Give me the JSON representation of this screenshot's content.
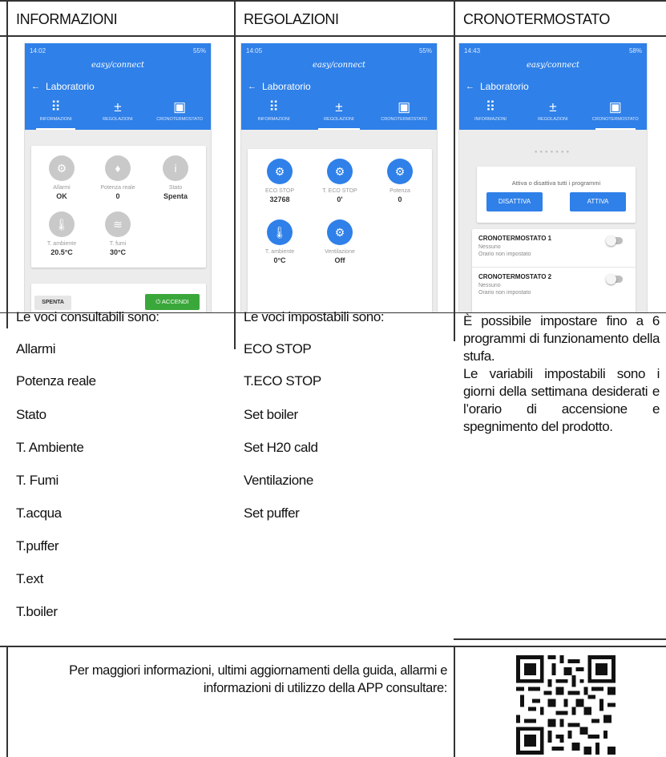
{
  "columns": [
    {
      "header": "INFORMAZIONI"
    },
    {
      "header": "REGOLAZIONI"
    },
    {
      "header": "CRONOTERMOSTATO"
    }
  ],
  "app": {
    "logo": "easy/connect",
    "title": "Laboratorio",
    "tabs": [
      "INFORMAZIONI",
      "REGOLAZIONI",
      "CRONOTERMOSTATO"
    ]
  },
  "phone1": {
    "status_time": "14:02",
    "status_right": "55%",
    "items": [
      {
        "label": "Allarmi",
        "value": "OK",
        "icon": "gear-icon"
      },
      {
        "label": "Potenza reale",
        "value": "0",
        "icon": "flame-icon"
      },
      {
        "label": "Stato",
        "value": "Spenta",
        "icon": "info-icon"
      },
      {
        "label": "T. ambiente",
        "value": "20.5°C",
        "icon": "thermometer-icon"
      },
      {
        "label": "T. fumi",
        "value": "30°C",
        "icon": "smoke-icon"
      }
    ],
    "off_button": "SPENTA",
    "on_button": "ACCENDI"
  },
  "phone2": {
    "status_time": "14:05",
    "status_right": "55%",
    "items": [
      {
        "label": "ECO STOP",
        "value": "32768",
        "icon": "gear-icon"
      },
      {
        "label": "T. ECO STOP",
        "value": "0'",
        "icon": "gear-icon"
      },
      {
        "label": "Potenza",
        "value": "0",
        "icon": "gear-icon"
      },
      {
        "label": "T. ambiente",
        "value": "0°C",
        "icon": "thermometer-icon"
      },
      {
        "label": "Ventilazione",
        "value": "Off",
        "icon": "gear-icon"
      }
    ]
  },
  "phone3": {
    "status_time": "14:43",
    "status_right": "58%",
    "toggle_all_text": "Attiva o disattiva tutti i programmi",
    "deactivate_button": "DISATTIVA",
    "activate_button": "ATTIVA",
    "programs": [
      {
        "name": "CRONOTERMOSTATO 1",
        "days": "Nessuno",
        "time": "Orario non impostato"
      },
      {
        "name": "CRONOTERMOSTATO 2",
        "days": "Nessuno",
        "time": "Orario non impostato"
      }
    ]
  },
  "col1": {
    "intro": "Le voci consultabili sono:",
    "items": [
      "Allarmi",
      "Potenza reale",
      "Stato",
      "T. Ambiente",
      "T. Fumi",
      "T.acqua",
      "T.puffer",
      "T.ext",
      "T.boiler"
    ]
  },
  "col2": {
    "intro": "Le voci impostabili sono:",
    "items": [
      "ECO STOP",
      "T.ECO STOP",
      "Set boiler",
      "Set H20 cald",
      "Ventilazione",
      "Set puffer"
    ]
  },
  "col3": {
    "para1": "È possibile impostare fino a 6 programmi di funzionamento della stufa.",
    "para2": "Le variabili impostabili sono i giorni della settimana desiderati e l’orario di accensione e spegnimento del prodotto."
  },
  "footer": {
    "text": "Per maggiori informazioni, ultimi aggiornamenti della guida, allarmi e informazioni di utilizzo della APP consultare:"
  }
}
